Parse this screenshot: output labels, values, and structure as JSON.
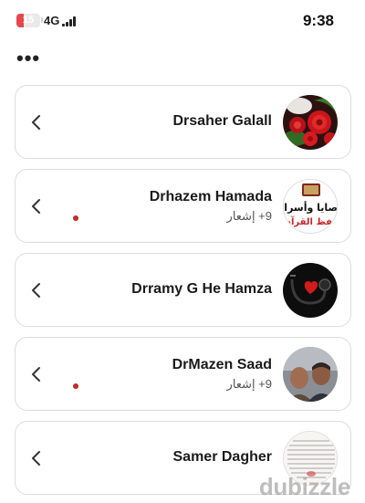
{
  "status_bar": {
    "battery_level": "15",
    "network": "4G",
    "time": "9:38",
    "icons": [
      "battery-icon",
      "signal-icon"
    ]
  },
  "menu": {
    "more_label": "•••"
  },
  "chats": [
    {
      "name": "Drsaher Galall",
      "notification": "",
      "avatar_icon": "roses-avatar"
    },
    {
      "name": "Drhazem Hamada",
      "notification": "9+ إشعار",
      "avatar_icon": "calligraphy-avatar",
      "avatar_text": [
        "وصايا وأسرار",
        "حفظ القرآن"
      ]
    },
    {
      "name": "Drramy G He Hamza",
      "notification": "",
      "avatar_icon": "stethoscope-heart-avatar"
    },
    {
      "name": "DrMazen Saad",
      "notification": "9+ إشعار",
      "avatar_icon": "photo-avatar"
    },
    {
      "name": "Samer Dagher",
      "notification": "",
      "avatar_icon": "document-avatar"
    }
  ],
  "watermark": "dubizzle",
  "colors": {
    "battery_low": "#e5484d",
    "notification_dot": "#c62828",
    "card_border": "#dcdcdc"
  }
}
